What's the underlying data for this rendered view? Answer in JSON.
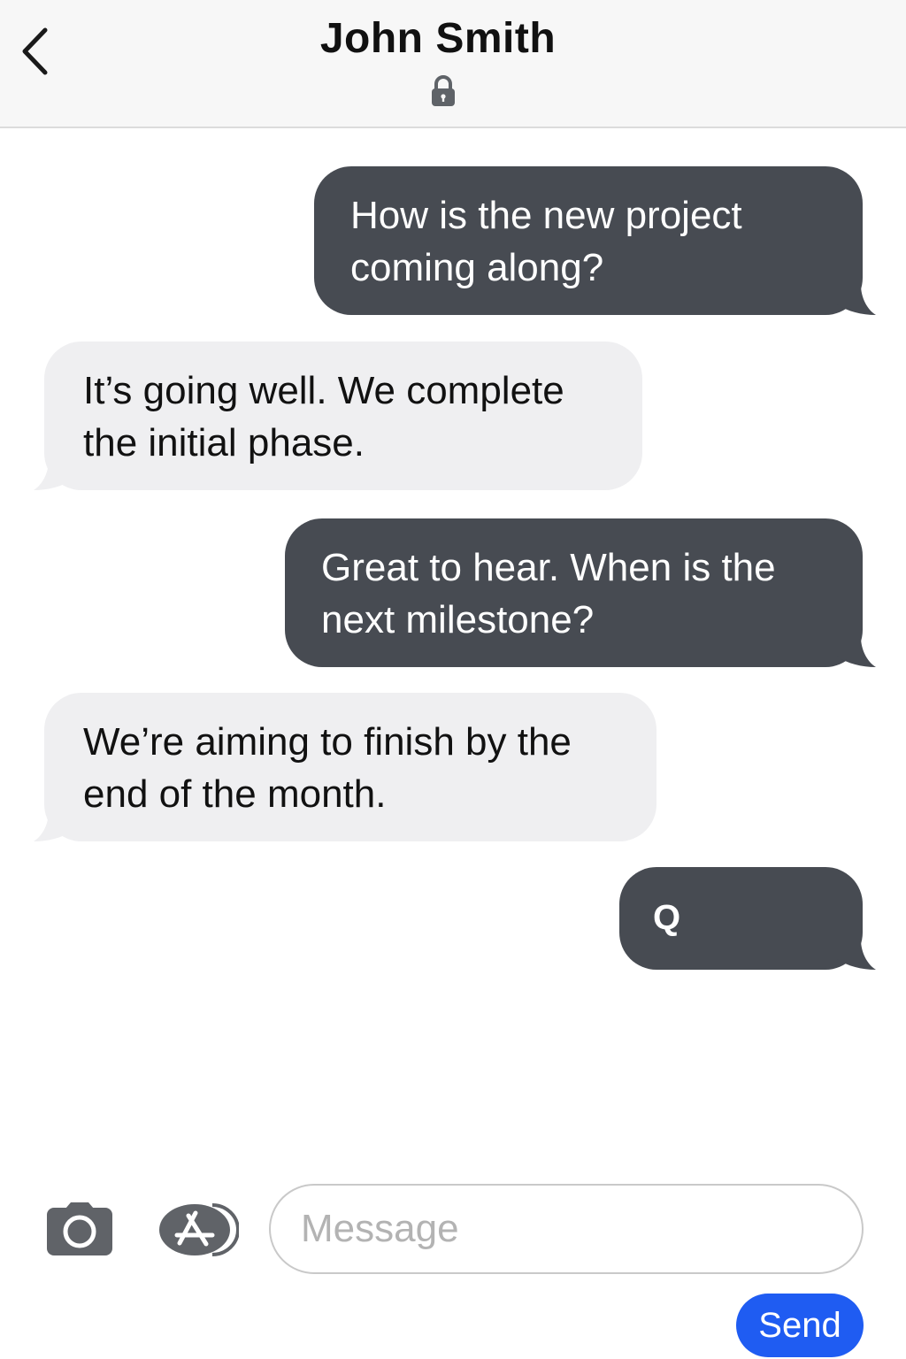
{
  "header": {
    "contact_name": "John Smith",
    "back_icon": "chevron-left-icon",
    "lock_icon": "lock-icon"
  },
  "messages": [
    {
      "direction": "outgoing",
      "lines": [
        "How is the new project",
        "coming along?"
      ]
    },
    {
      "direction": "incoming",
      "lines": [
        "It’s going well. We complete",
        "the initial phase."
      ]
    },
    {
      "direction": "outgoing",
      "lines": [
        "Great to hear. When is the",
        "next milestone?"
      ]
    },
    {
      "direction": "incoming",
      "lines": [
        "We’re aiming to finish by the",
        "end of the month."
      ]
    },
    {
      "direction": "outgoing",
      "lines": [
        "Q"
      ]
    }
  ],
  "composer": {
    "camera_icon": "camera-icon",
    "app_store_icon": "app-store-icon",
    "placeholder": "Message",
    "value": "",
    "send_label": "Send"
  },
  "colors": {
    "outgoing_bubble": "#474b52",
    "incoming_bubble": "#efeff1",
    "send_button": "#1f5cf2",
    "header_background": "#f7f7f7"
  }
}
